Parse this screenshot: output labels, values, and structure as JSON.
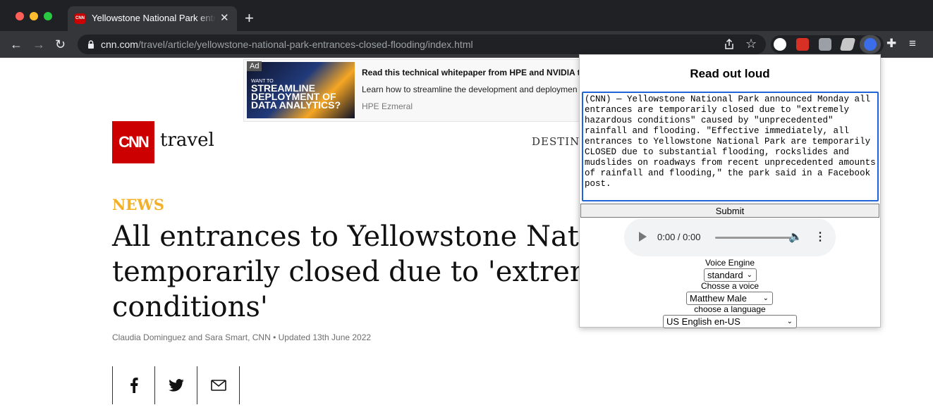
{
  "browser": {
    "tab_title": "Yellowstone National Park entra",
    "url_host": "cnn.com",
    "url_path": "/travel/article/yellowstone-national-park-entrances-closed-flooding/index.html",
    "tab_favicon_text": "CNN"
  },
  "ad": {
    "badge": "Ad",
    "title": "Read this technical whitepaper from HPE and NVIDIA t",
    "description": "Learn how to streamline the development and deploymen",
    "brand": "HPE Ezmeral",
    "image_small_text": "WANT TO",
    "image_text": "STREAMLINE DEPLOYMENT OF DATA ANALYTICS?"
  },
  "site": {
    "logo_text": "CNN",
    "section": "travel",
    "nav_destinations": "DESTINAT"
  },
  "article": {
    "kicker": "NEWS",
    "headline_line1": "All entrances to Yellowstone Nationa",
    "headline_line2": "temporarily closed due to 'extremely",
    "headline_line3": "conditions'",
    "byline": "Claudia Dominguez and Sara Smart, CNN • Updated 13th June 2022"
  },
  "popup": {
    "title": "Read out loud",
    "text": "(CNN) — Yellowstone National Park announced Monday all entrances are temporarily closed due to \"extremely hazardous conditions\" caused by \"unprecedented\" rainfall and flooding. \"Effective immediately, all entrances to Yellowstone National Park are temporarily CLOSED due to substantial flooding, rockslides and mudslides on roadways from recent unprecedented amounts of rainfall and flooding,\" the park said in a Facebook post.",
    "submit_label": "Submit",
    "audio_time": "0:00 / 0:00",
    "voice_engine_label": "Voice Engine",
    "voice_engine_value": "standard",
    "voice_label": "Chosse a voice",
    "voice_value": "Matthew Male",
    "language_label": "choose a language",
    "language_value": "US English en-US"
  },
  "colors": {
    "cnn_red": "#cc0000",
    "news_gold": "#f2b02a",
    "focus_blue": "#2064d8"
  }
}
